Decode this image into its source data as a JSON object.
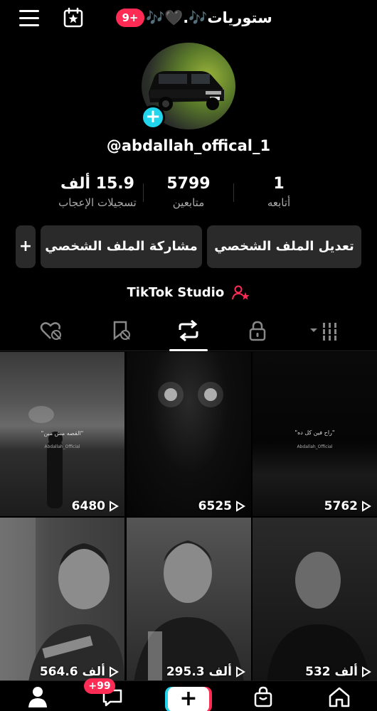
{
  "header": {
    "notification_badge": "9+",
    "title": "ستوريات🎶.🖤🎶"
  },
  "profile": {
    "handle": "@abdallah_offical_1",
    "stats": [
      {
        "value": "1",
        "label": "أتابعه"
      },
      {
        "value": "5799",
        "label": "متابعين"
      },
      {
        "value": "15.9 ألف",
        "label": "تسجيلات الإعجاب"
      }
    ]
  },
  "actions": {
    "edit_profile": "تعديل الملف الشخصي",
    "share_profile": "مشاركة الملف الشخصي",
    "add_friend": "+"
  },
  "studio": {
    "label": "TikTok Studio"
  },
  "tabs": [
    {
      "icon": "videos-grid-icon"
    },
    {
      "icon": "private-lock-icon"
    },
    {
      "icon": "reposts-icon"
    },
    {
      "icon": "favorites-hidden-icon"
    },
    {
      "icon": "liked-hidden-icon"
    }
  ],
  "videos": [
    {
      "views": "5762",
      "caption": "\"راح فين كل ده\"",
      "watermark": "Abdallah_Official"
    },
    {
      "views": "6525",
      "caption": "",
      "watermark": ""
    },
    {
      "views": "6480",
      "caption": "\"القصه مش مين\"",
      "watermark": "Abdallah_Official"
    },
    {
      "views": "532 ألف"
    },
    {
      "views": "295.3 ألف"
    },
    {
      "views": "564.6 ألف"
    }
  ],
  "bottom_nav": {
    "inbox_badge": "+99",
    "create_label": "+"
  },
  "colors": {
    "accent_red": "#fe2c55",
    "accent_cyan": "#20d5ec",
    "button_bg": "#2a2a2a"
  }
}
